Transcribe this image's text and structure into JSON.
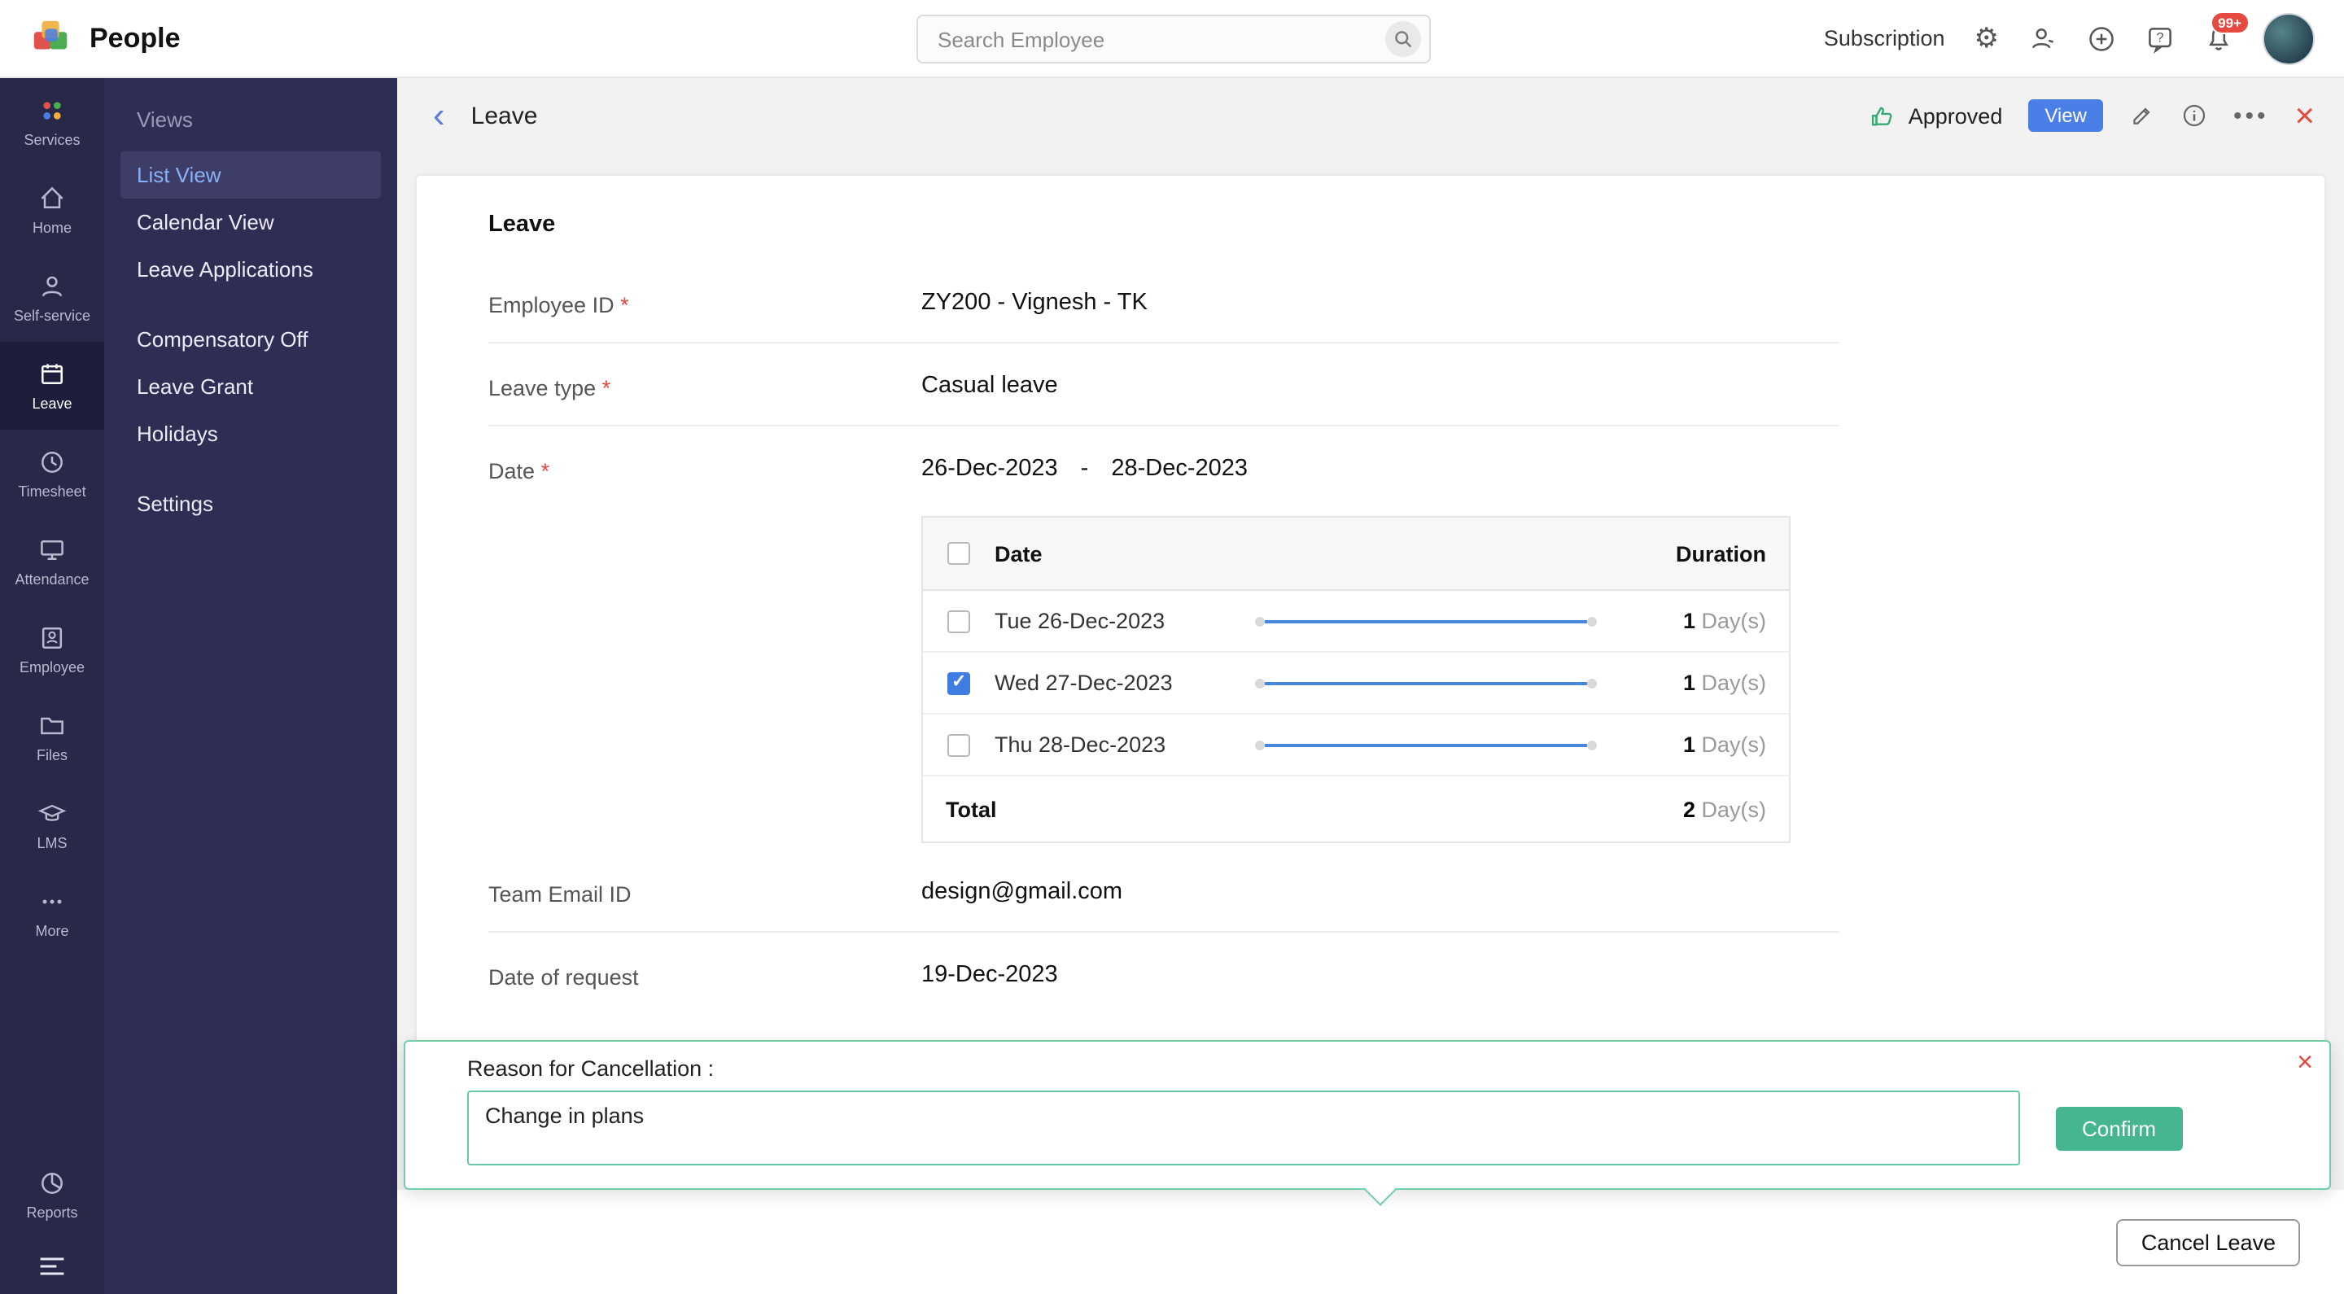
{
  "colors": {
    "accent_blue": "#4a7fe8",
    "success_green": "#45b690",
    "danger_red": "#e5493f",
    "sidebar_navy": "#2e2e55",
    "slider_blue": "#4a86d8"
  },
  "topbar": {
    "app_name": "People",
    "search_placeholder": "Search Employee",
    "subscription_label": "Subscription",
    "notification_badge": "99+"
  },
  "rail": {
    "items": [
      {
        "label": "Services"
      },
      {
        "label": "Home"
      },
      {
        "label": "Self-service"
      },
      {
        "label": "Leave"
      },
      {
        "label": "Timesheet"
      },
      {
        "label": "Attendance"
      },
      {
        "label": "Employee"
      },
      {
        "label": "Files"
      },
      {
        "label": "LMS"
      },
      {
        "label": "More"
      }
    ],
    "bottom": {
      "reports_label": "Reports"
    }
  },
  "subnav": {
    "title": "Views",
    "views": [
      {
        "label": "List View",
        "active": true
      },
      {
        "label": "Calendar View",
        "active": false
      },
      {
        "label": "Leave Applications",
        "active": false
      }
    ],
    "sections": [
      {
        "label": "Compensatory Off"
      },
      {
        "label": "Leave Grant"
      },
      {
        "label": "Holidays"
      },
      {
        "label": "Settings"
      }
    ]
  },
  "main_header": {
    "title": "Leave",
    "status": "Approved",
    "status_badge": "View"
  },
  "form": {
    "heading": "Leave",
    "fields": {
      "employee_id": {
        "label": "Employee ID",
        "required": true,
        "value": "ZY200 - Vignesh - TK"
      },
      "leave_type": {
        "label": "Leave type",
        "required": true,
        "value": "Casual leave"
      },
      "date": {
        "label": "Date",
        "required": true,
        "start": "26-Dec-2023",
        "separator": "-",
        "end": "28-Dec-2023"
      },
      "team_email": {
        "label": "Team Email ID",
        "required": false,
        "value": "design@gmail.com"
      },
      "date_of_request": {
        "label": "Date of request",
        "required": false,
        "value": "19-Dec-2023"
      }
    }
  },
  "day_table": {
    "header": {
      "date": "Date",
      "duration": "Duration"
    },
    "rows": [
      {
        "date": "Tue 26-Dec-2023",
        "value": "1",
        "unit": "Day(s)",
        "checked": false
      },
      {
        "date": "Wed 27-Dec-2023",
        "value": "1",
        "unit": "Day(s)",
        "checked": true
      },
      {
        "date": "Thu 28-Dec-2023",
        "value": "1",
        "unit": "Day(s)",
        "checked": false
      }
    ],
    "total": {
      "label": "Total",
      "value": "2",
      "unit": "Day(s)"
    }
  },
  "popup": {
    "label": "Reason for Cancellation :",
    "reason": "Change in plans",
    "confirm_label": "Confirm"
  },
  "footer": {
    "cancel_label": "Cancel Leave"
  }
}
